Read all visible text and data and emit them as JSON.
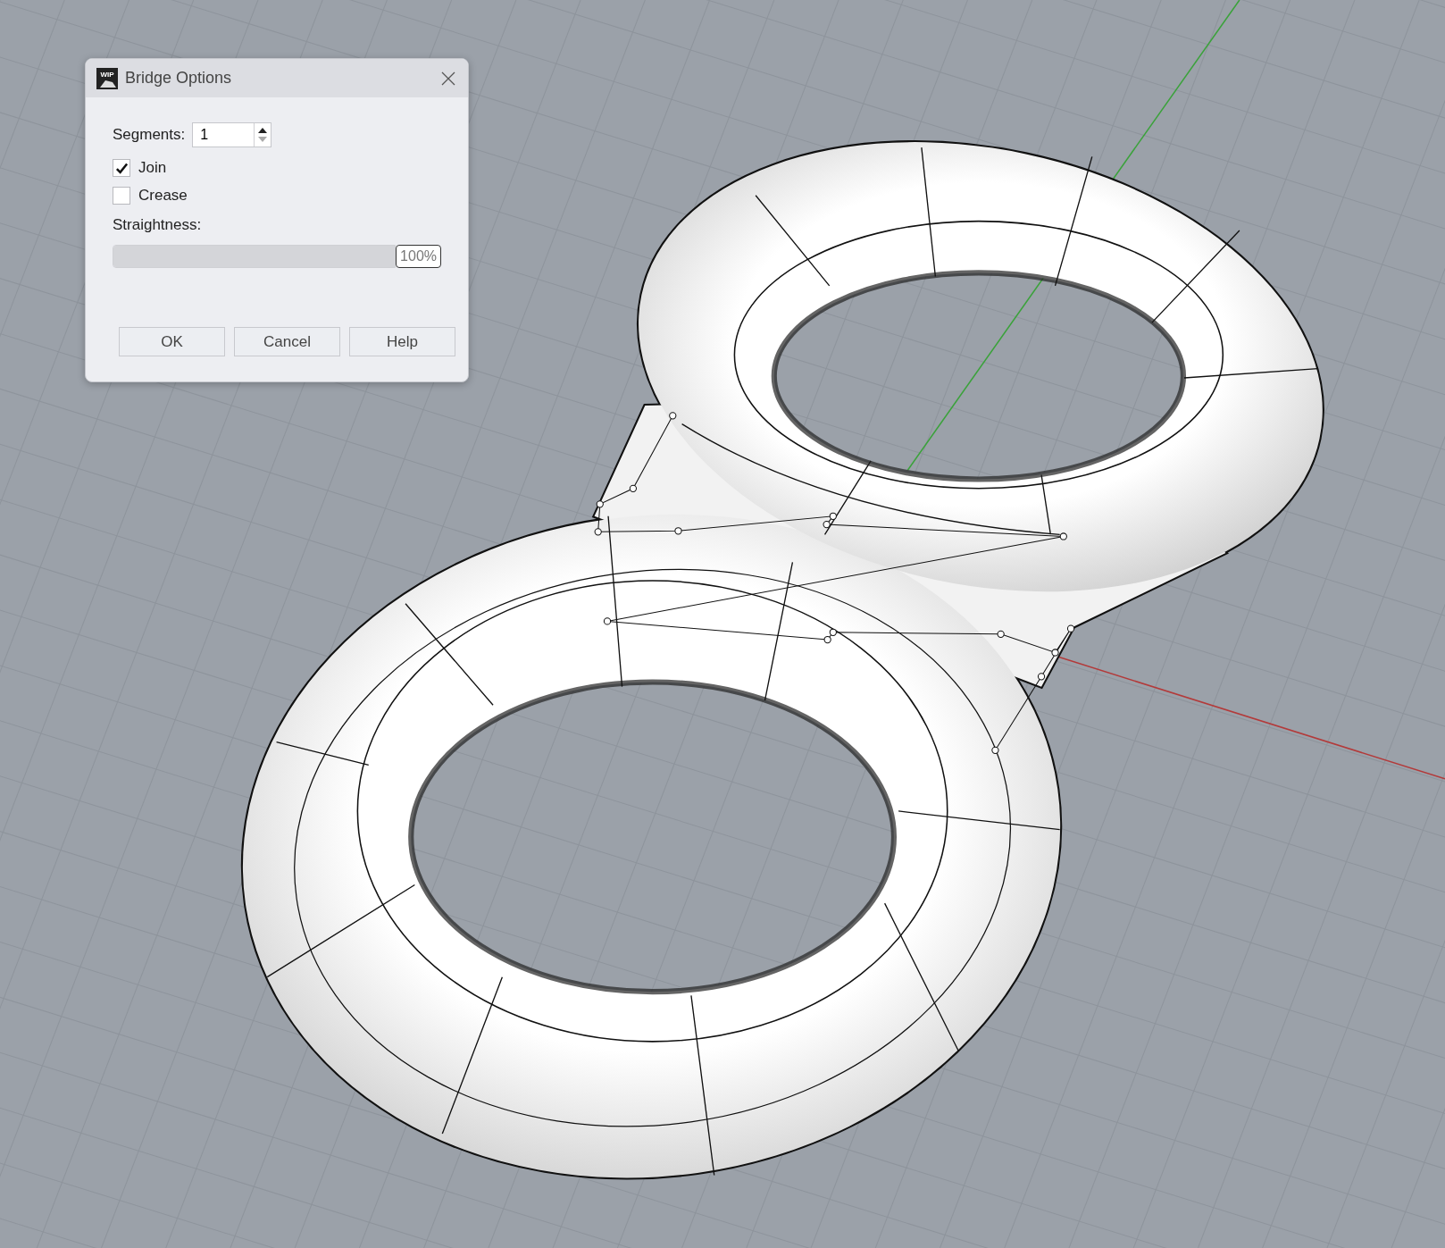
{
  "dialog": {
    "icon_badge": "WIP",
    "title": "Bridge Options",
    "segments": {
      "label": "Segments:",
      "value": "1",
      "up_disabled": false,
      "down_disabled": true
    },
    "checkboxes": [
      {
        "label": "Join",
        "checked": true
      },
      {
        "label": "Crease",
        "checked": false
      }
    ],
    "straightness": {
      "label": "Straightness:",
      "level": 1,
      "reading": "100%"
    },
    "buttons": [
      "OK",
      "Cancel",
      "Help"
    ]
  }
}
